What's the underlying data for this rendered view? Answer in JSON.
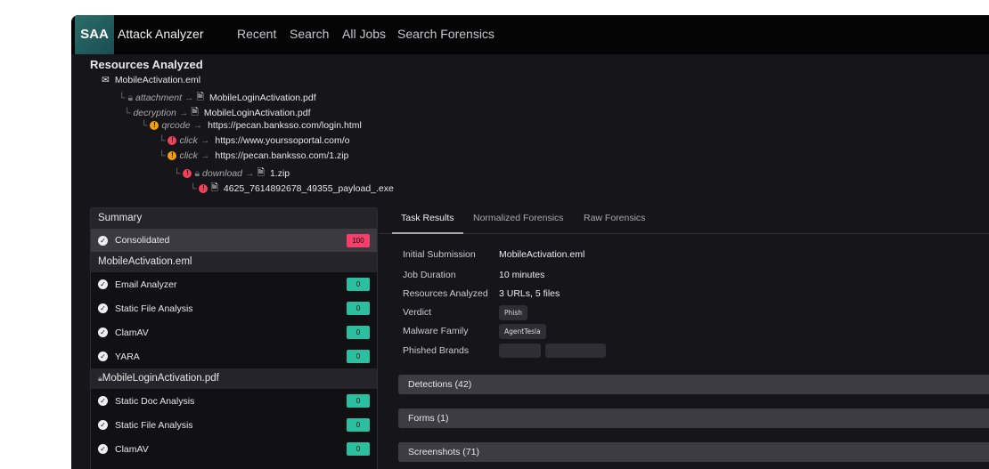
{
  "header": {
    "logo": "SAA",
    "app_title": "Attack Analyzer",
    "nav": [
      "Recent",
      "Search",
      "All Jobs",
      "Search Forensics"
    ]
  },
  "resources": {
    "title": "Resources Analyzed",
    "tree": [
      {
        "icon": "mail-icon",
        "rel": "",
        "name": "MobileActivation.eml"
      },
      {
        "icon": "pdf-file-icon",
        "lock": true,
        "rel": "attachment",
        "name": "MobileLoginActivation.pdf"
      },
      {
        "icon": "pdf-file-icon",
        "rel": "decryption",
        "name": "MobileLoginActivation.pdf"
      },
      {
        "alert": "warning",
        "rel": "qrcode",
        "name": "https://pecan.banksso.com/login.html"
      },
      {
        "alert": "danger",
        "rel": "click",
        "name": "https://www.yourssoportal.com/o"
      },
      {
        "alert": "warning",
        "rel": "click",
        "name": "https://pecan.banksso.com/1.zip"
      },
      {
        "alert": "danger",
        "lock": true,
        "icon": "zip-file-icon",
        "rel": "download",
        "name": "1.zip"
      },
      {
        "alert": "danger",
        "icon": "file-icon",
        "rel": "",
        "name": "4625_7614892678_49355_payload_.exe"
      }
    ]
  },
  "summary": {
    "title": "Summary",
    "consolidated": {
      "label": "Consolidated",
      "score": "100"
    },
    "groups": [
      {
        "name": "MobileActivation.eml",
        "items": [
          {
            "label": "Email Analyzer",
            "score": "0"
          },
          {
            "label": "Static File Analysis",
            "score": "0"
          },
          {
            "label": "ClamAV",
            "score": "0"
          },
          {
            "label": "YARA",
            "score": "0"
          }
        ]
      },
      {
        "name": "MobileLoginActivation.pdf",
        "locked": true,
        "items": [
          {
            "label": "Static Doc Analysis",
            "score": "0"
          },
          {
            "label": "Static File Analysis",
            "score": "0"
          },
          {
            "label": "ClamAV",
            "score": "0"
          }
        ]
      }
    ]
  },
  "tabs": [
    "Task Results",
    "Normalized Forensics",
    "Raw Forensics"
  ],
  "details": {
    "initial_submission_label": "Initial Submission",
    "initial_submission": "MobileActivation.eml",
    "job_duration_label": "Job Duration",
    "job_duration": "10 minutes",
    "resources_label": "Resources Analyzed",
    "resources": "3 URLs, 5 files",
    "verdict_label": "Verdict",
    "verdict": "Phish",
    "malware_family_label": "Malware Family",
    "malware_family": "AgentTesla",
    "phished_brands_label": "Phished Brands"
  },
  "sections": [
    "Detections (42)",
    "Forms (1)",
    "Screenshots (71)"
  ],
  "colors": {
    "warning": "#f59e0b",
    "danger": "#f43f5e",
    "score_ok": "#2bbf9f",
    "score_bad": "#f43f6b"
  }
}
